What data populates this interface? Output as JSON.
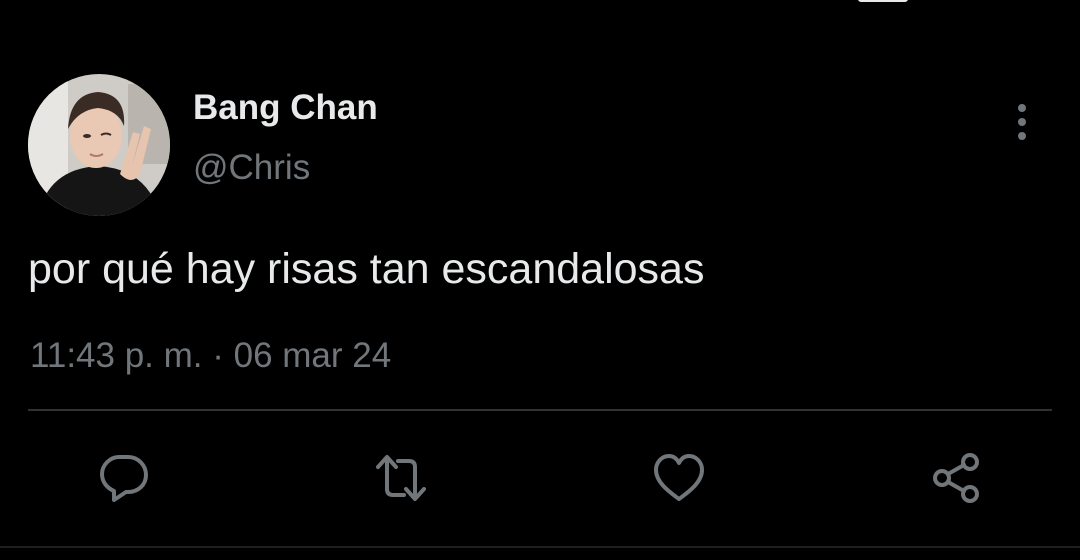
{
  "tweet": {
    "author": {
      "display_name": "Bang Chan",
      "handle": "@Chris",
      "avatar_icon": "profile-photo"
    },
    "text": "por qué hay risas tan escandalosas",
    "timestamp": "11:43 p. m. · 06 mar 24"
  },
  "actions": [
    {
      "name": "reply",
      "icon": "reply-icon"
    },
    {
      "name": "retweet",
      "icon": "retweet-icon"
    },
    {
      "name": "like",
      "icon": "heart-icon"
    },
    {
      "name": "share",
      "icon": "share-icon"
    }
  ],
  "colors": {
    "background": "#000000",
    "primary_text": "#e7e9ea",
    "secondary_text": "#71767b",
    "divider": "#2f3336"
  }
}
